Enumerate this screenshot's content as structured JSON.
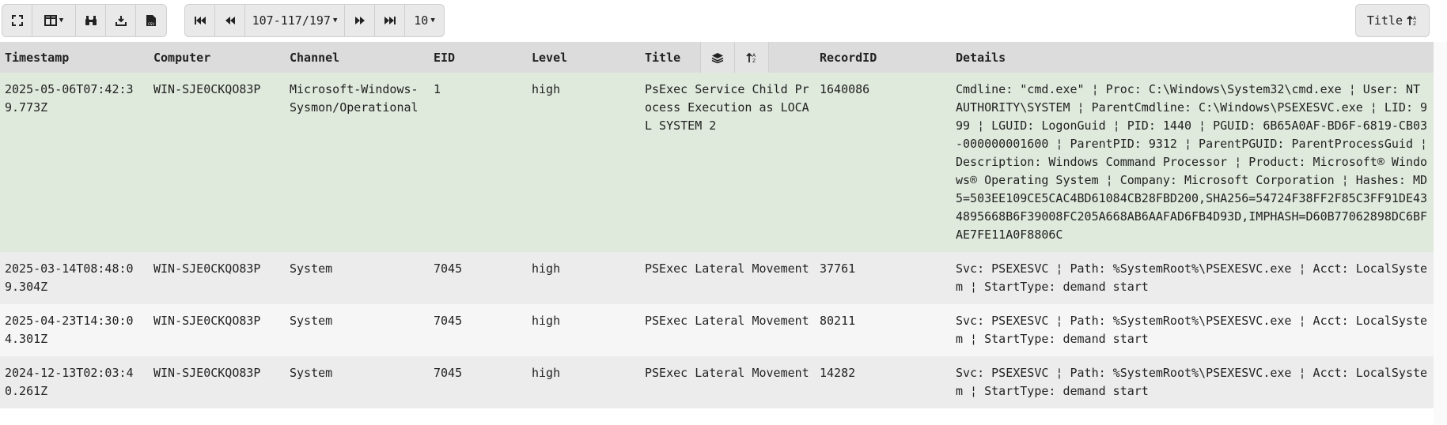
{
  "toolbar": {
    "page_range": "107-117/197",
    "page_size": "10",
    "sort_button_label": "Title",
    "icons": [
      "fullscreen-icon",
      "columns-icon",
      "binoculars-icon",
      "download-icon",
      "csv-file-icon",
      "first-page-icon",
      "previous-page-icon",
      "next-page-icon",
      "last-page-icon",
      "sort-icon"
    ]
  },
  "table": {
    "headers": [
      "Timestamp",
      "Computer",
      "Channel",
      "EID",
      "Level",
      "Title",
      "RecordID",
      "Details"
    ],
    "rows": [
      {
        "timestamp": "2025-05-06T07:42:39.773Z",
        "computer": "WIN-SJE0CKQO83P",
        "channel": "Microsoft-Windows-Sysmon/Operational",
        "eid": "1",
        "level": "high",
        "title": "PsExec Service Child Process Execution as LOCAL SYSTEM 2",
        "recordid": "1640086",
        "details": "Cmdline: \"cmd.exe\" ¦ Proc: C:\\Windows\\System32\\cmd.exe ¦ User: NT AUTHORITY\\SYSTEM ¦ ParentCmdline: C:\\Windows\\PSEXESVC.exe ¦ LID: 999 ¦ LGUID: LogonGuid ¦ PID: 1440 ¦ PGUID: 6B65A0AF-BD6F-6819-CB03-000000001600 ¦ ParentPID: 9312 ¦ ParentPGUID: ParentProcessGuid ¦ Description: Windows Command Processor ¦ Product: Microsoft® Windows® Operating System ¦ Company: Microsoft Corporation ¦ Hashes: MD5=503EE109CE5CAC4BD61084CB28FBD200,SHA256=54724F38FF2F85C3FF91DE434895668B6F39008FC205A668AB6AAFAD6FB4D93D,IMPHASH=D60B77062898DC6BFAE7FE11A0F8806C"
      },
      {
        "timestamp": "2025-03-14T08:48:09.304Z",
        "computer": "WIN-SJE0CKQO83P",
        "channel": "System",
        "eid": "7045",
        "level": "high",
        "title": "PSExec Lateral Movement",
        "recordid": "37761",
        "details": "Svc: PSEXESVC ¦ Path: %SystemRoot%\\PSEXESVC.exe ¦ Acct: LocalSystem ¦ StartType: demand start"
      },
      {
        "timestamp": "2025-04-23T14:30:04.301Z",
        "computer": "WIN-SJE0CKQO83P",
        "channel": "System",
        "eid": "7045",
        "level": "high",
        "title": "PSExec Lateral Movement",
        "recordid": "80211",
        "details": "Svc: PSEXESVC ¦ Path: %SystemRoot%\\PSEXESVC.exe ¦ Acct: LocalSystem ¦ StartType: demand start"
      },
      {
        "timestamp": "2024-12-13T02:03:40.261Z",
        "computer": "WIN-SJE0CKQO83P",
        "channel": "System",
        "eid": "7045",
        "level": "high",
        "title": "PSExec Lateral Movement",
        "recordid": "14282",
        "details": "Svc: PSEXESVC ¦ Path: %SystemRoot%\\PSEXESVC.exe ¦ Acct: LocalSystem ¦ StartType: demand start"
      }
    ]
  }
}
